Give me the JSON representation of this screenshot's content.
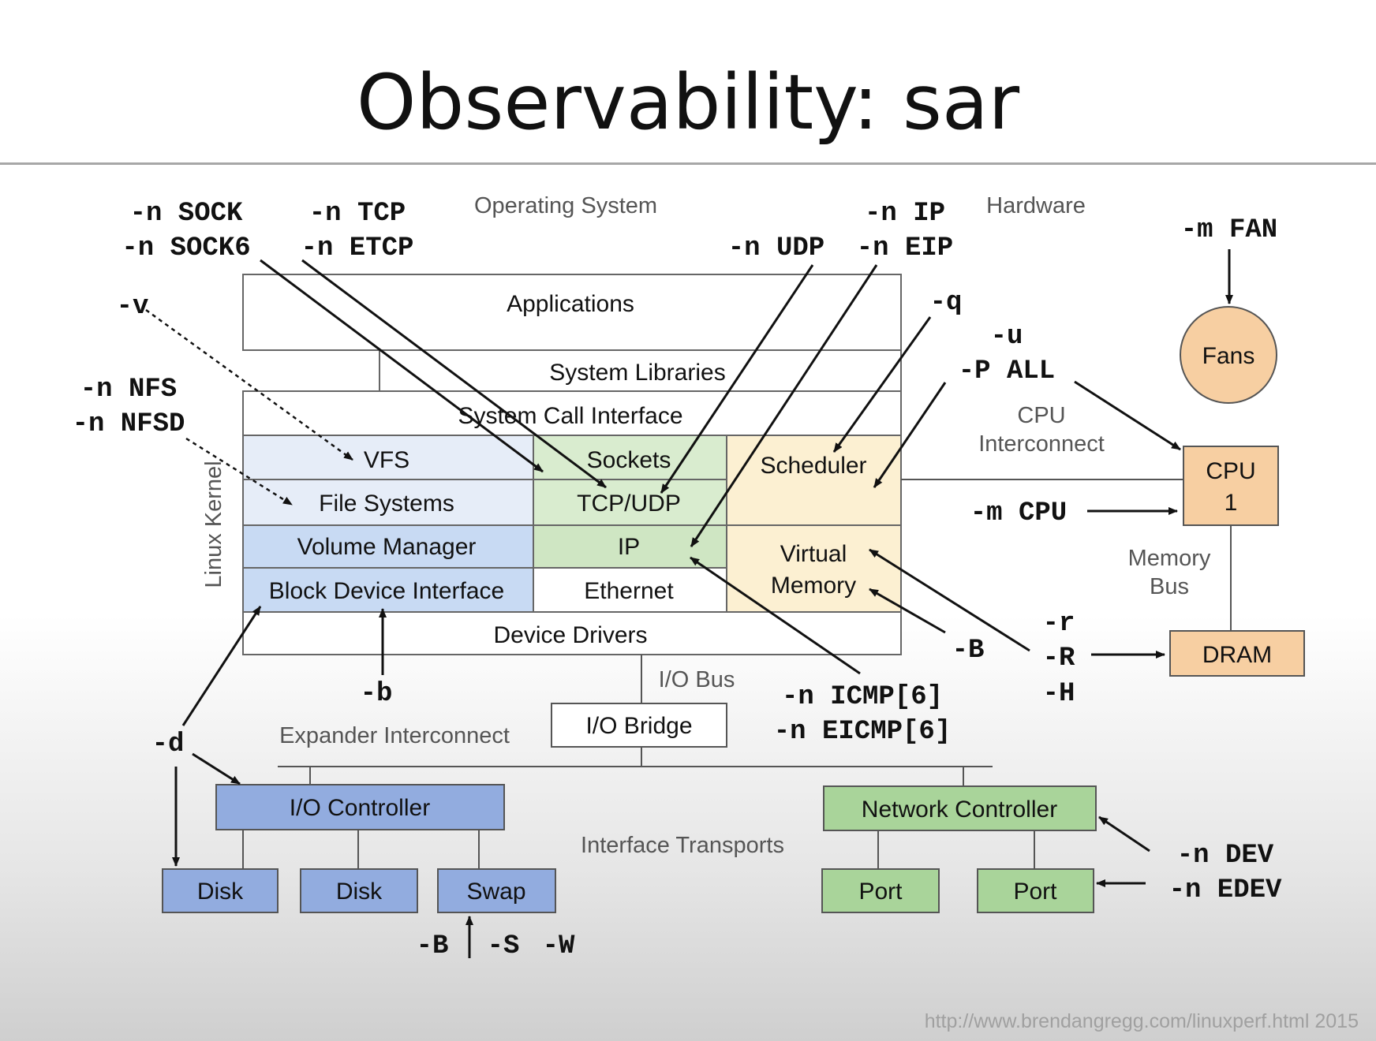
{
  "title": "Observability: sar",
  "sections": {
    "os": "Operating System",
    "hardware": "Hardware",
    "kernel": "Linux Kernel"
  },
  "layers": {
    "applications": "Applications",
    "system_libraries": "System Libraries",
    "system_call_interface": "System Call Interface",
    "vfs": "VFS",
    "file_systems": "File Systems",
    "volume_manager": "Volume Manager",
    "block_device_interface": "Block Device Interface",
    "sockets": "Sockets",
    "tcp_udp": "TCP/UDP",
    "ip": "IP",
    "ethernet": "Ethernet",
    "scheduler": "Scheduler",
    "virtual_memory_1": "Virtual",
    "virtual_memory_2": "Memory",
    "device_drivers": "Device Drivers"
  },
  "hardware": {
    "fans": "Fans",
    "cpu_1": "CPU",
    "cpu_2": "1",
    "dram": "DRAM",
    "cpu_interconnect_1": "CPU",
    "cpu_interconnect_2": "Interconnect",
    "memory_bus_1": "Memory",
    "memory_bus_2": "Bus",
    "io_bus": "I/O Bus",
    "io_bridge": "I/O Bridge",
    "expander_interconnect": "Expander Interconnect",
    "io_controller": "I/O Controller",
    "disk_1": "Disk",
    "disk_2": "Disk",
    "swap": "Swap",
    "interface_transports": "Interface Transports",
    "network_controller": "Network Controller",
    "port_1": "Port",
    "port_2": "Port"
  },
  "flags": {
    "n_sock": "-n SOCK",
    "n_sock6": "-n SOCK6",
    "n_tcp": "-n TCP",
    "n_etcp": "-n ETCP",
    "n_ip": "-n IP",
    "n_udp": "-n UDP",
    "n_eip": "-n EIP",
    "m_fan": "-m FAN",
    "v": "-v",
    "q": "-q",
    "u": "-u",
    "p_all": "-P ALL",
    "n_nfs": "-n NFS",
    "n_nfsd": "-n NFSD",
    "m_cpu": "-m CPU",
    "r_lower": "-r",
    "r_upper": "-R",
    "h": "-H",
    "b_upper": "-B",
    "b_lower": "-b",
    "n_icmp": "-n ICMP[6]",
    "n_eicmp": "-n EICMP[6]",
    "d": "-d",
    "n_dev": "-n DEV",
    "n_edev": "-n EDEV",
    "b_swap": "-B",
    "s_swap": "-S",
    "w_swap": "-W"
  },
  "footer": "http://www.brendangregg.com/linuxperf.html 2015",
  "colors": {
    "fs_blue": "#e6edf8",
    "block_blue": "#c8daf3",
    "net_green": "#d9eccf",
    "net_green_dark": "#cfe6c3",
    "sched_yellow": "#fcf0d2",
    "cpu_orange": "#f7cfa2",
    "hw_blue": "#92acdf",
    "hw_green": "#a9d49a"
  }
}
